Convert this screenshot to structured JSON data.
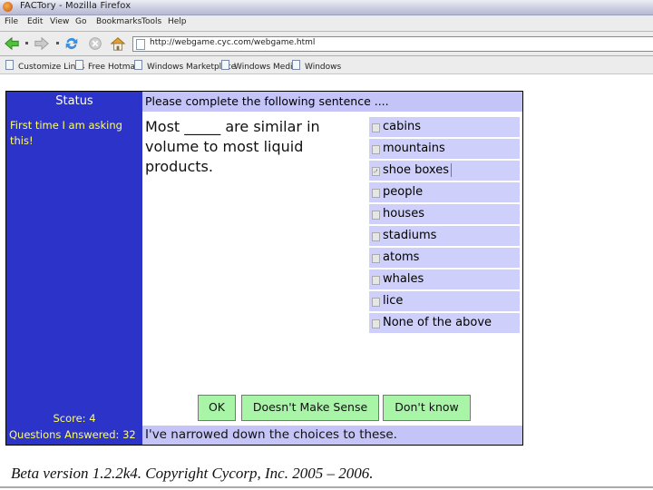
{
  "browser": {
    "window_title": "FACTory - Mozilla Firefox",
    "menu": [
      "File",
      "Edit",
      "View",
      "Go",
      "Bookmarks",
      "Tools",
      "Help"
    ],
    "url": "http://webgame.cyc.com/webgame.html",
    "bookmarks": [
      "Customize Links",
      "Free Hotmail",
      "Windows Marketplace",
      "Windows Media",
      "Windows"
    ],
    "icons": [
      "back-arrow-icon",
      "forward-arrow-icon",
      "reload-icon",
      "stop-icon",
      "home-icon"
    ]
  },
  "status": {
    "heading": "Status",
    "message": "First time I am asking this!",
    "score": "Score: 4",
    "questions_answered": "Questions Answered: 32"
  },
  "question": {
    "prompt": "Please complete the following sentence ....",
    "sentence": "Most _____ are similar in volume to most liquid products.",
    "choices": [
      {
        "label": "cabins",
        "checked": false
      },
      {
        "label": "mountains",
        "checked": false
      },
      {
        "label": "shoe boxes",
        "checked": true
      },
      {
        "label": "people",
        "checked": false
      },
      {
        "label": "houses",
        "checked": false
      },
      {
        "label": "stadiums",
        "checked": false
      },
      {
        "label": "atoms",
        "checked": false
      },
      {
        "label": "whales",
        "checked": false
      },
      {
        "label": "lice",
        "checked": false
      },
      {
        "label": "None of the above",
        "checked": false
      }
    ]
  },
  "buttons": {
    "ok": "OK",
    "doesnt_make_sense": "Doesn't Make Sense",
    "dont_know": "Don't know"
  },
  "feedback": "I've narrowed down the choices to these.",
  "footer": "Beta version 1.2.2k4. Copyright Cycorp, Inc. 2005 – 2006.",
  "colors": {
    "status_bg": "#2b33c9",
    "status_text": "#ffff66",
    "bar_bg": "#c4c4f8",
    "choice_bg": "#cfcffb",
    "button_bg": "#a8f5a8"
  }
}
